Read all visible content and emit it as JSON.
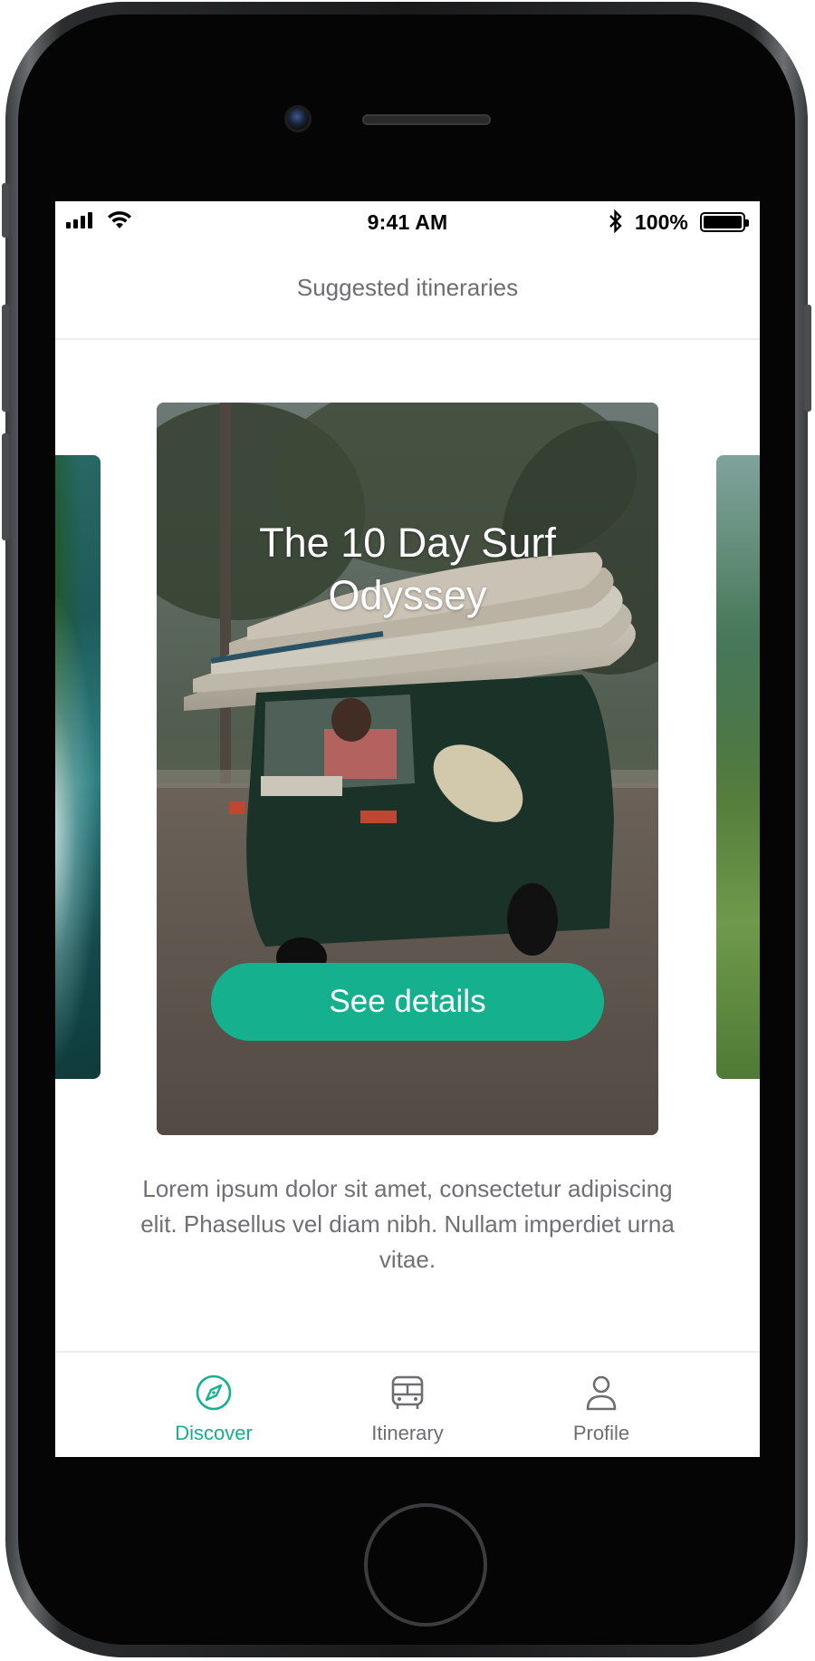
{
  "status_bar": {
    "time": "9:41 AM",
    "battery_percent": "100%",
    "icons": [
      "signal-icon",
      "wifi-icon",
      "bluetooth-icon",
      "battery-icon"
    ]
  },
  "header": {
    "title": "Suggested itineraries"
  },
  "carousel": {
    "current_card": {
      "title": "The 10 Day Surf Odyssey",
      "cta_label": "See details",
      "description": "Lorem ipsum dolor sit amet, consectetur adipiscing elit. Phasellus vel diam nibh. Nullam imperdiet urna vitae."
    }
  },
  "tab_bar": {
    "items": [
      {
        "label": "Discover",
        "icon": "compass-icon",
        "active": true
      },
      {
        "label": "Itinerary",
        "icon": "bus-icon",
        "active": false
      },
      {
        "label": "Profile",
        "icon": "user-icon",
        "active": false
      }
    ]
  },
  "colors": {
    "accent": "#15b08e",
    "text_muted": "#707074",
    "divider": "#ececec"
  }
}
